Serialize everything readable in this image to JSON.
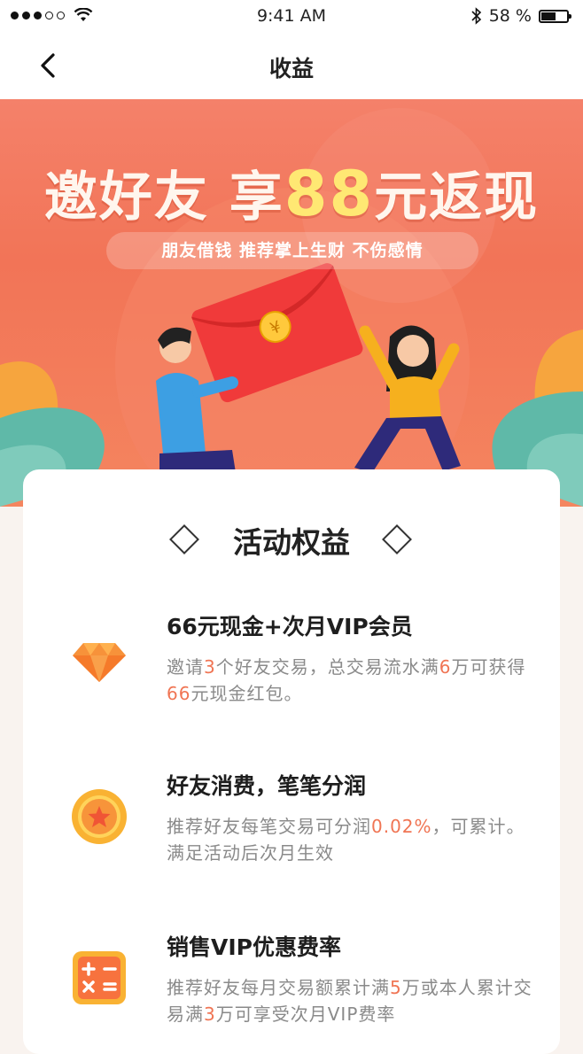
{
  "status": {
    "time": "9:41 AM",
    "battery": "58 %",
    "battery_level": 0.58
  },
  "nav": {
    "title": "收益"
  },
  "banner": {
    "title_before": "邀好友 享",
    "title_num": "88",
    "title_after": "元返现",
    "subtitle": "朋友借钱  推荐掌上生财  不伤感情",
    "coin_char": "¥"
  },
  "card": {
    "title": "活动权益",
    "benefits": [
      {
        "icon": "diamond-icon",
        "title": "66元现金+次月VIP会员",
        "desc": [
          {
            "t": "邀请"
          },
          {
            "t": "3",
            "hl": true
          },
          {
            "t": "个好友交易，总交易流水满"
          },
          {
            "t": "6",
            "hl": true
          },
          {
            "t": "万可获得"
          },
          {
            "t": "66",
            "hl": true
          },
          {
            "t": "元现金红包。"
          }
        ]
      },
      {
        "icon": "star-coin-icon",
        "title": "好友消费，笔笔分润",
        "desc": [
          {
            "t": "推荐好友每笔交易可分润"
          },
          {
            "t": "0.02%",
            "hl": true
          },
          {
            "t": "，可累计。满足活动后次月生效"
          }
        ]
      },
      {
        "icon": "calculator-icon",
        "title": "销售VIP优惠费率",
        "desc": [
          {
            "t": "推荐好友每月交易额累计满"
          },
          {
            "t": "5",
            "hl": true
          },
          {
            "t": "万或本人累计交易满"
          },
          {
            "t": "3",
            "hl": true
          },
          {
            "t": "万可享受次月VIP费率"
          }
        ]
      }
    ]
  },
  "colors": {
    "accent": "#f07554",
    "banner": "#f27457",
    "gold": "#ffe873"
  }
}
